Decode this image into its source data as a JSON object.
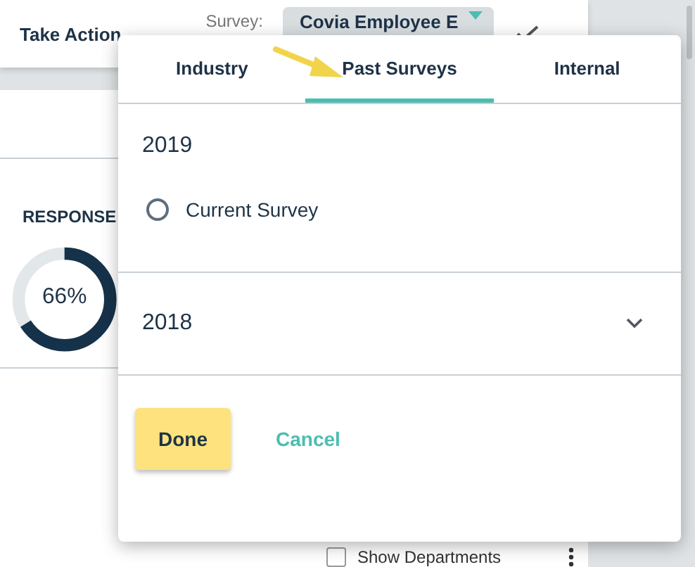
{
  "header": {
    "title": "Take Action",
    "survey_label": "Survey:",
    "survey_value": "Covia Employee E"
  },
  "response": {
    "title": "RESPONSE",
    "percent": "66%",
    "level": 0.66
  },
  "show_departments": {
    "label": "Show Departments",
    "checked": false
  },
  "popup": {
    "tabs": [
      {
        "label": "Industry",
        "selected": false
      },
      {
        "label": "Past Surveys",
        "selected": true
      },
      {
        "label": "Internal",
        "selected": false
      }
    ],
    "groups": [
      {
        "year": "2019",
        "expanded": true,
        "options": [
          {
            "label": "Current Survey",
            "selected": false
          }
        ]
      },
      {
        "year": "2018",
        "expanded": false
      }
    ],
    "buttons": [
      {
        "label": "Done",
        "kind": "primary"
      },
      {
        "label": "Cancel",
        "kind": "link"
      }
    ]
  }
}
